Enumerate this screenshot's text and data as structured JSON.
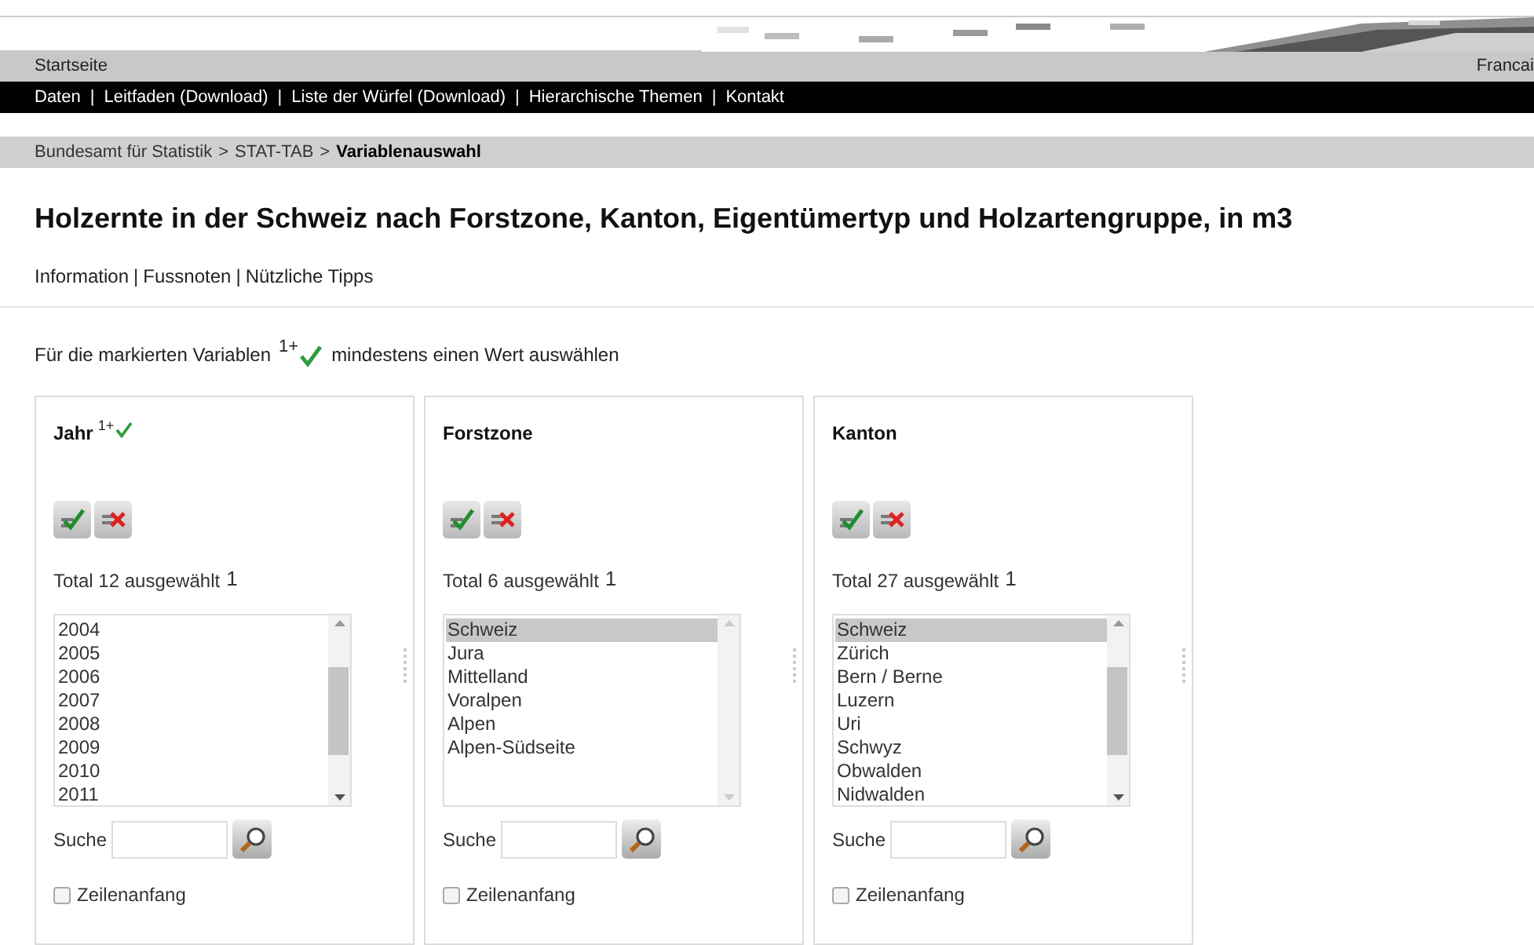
{
  "top_bar": {
    "home": "Startseite",
    "language": "Francai"
  },
  "nav": {
    "separator": "|",
    "items": [
      "Daten",
      "Leitfaden (Download)",
      "Liste der Würfel (Download)",
      "Hierarchische Themen",
      "Kontakt"
    ]
  },
  "breadcrumb": {
    "separator": ">",
    "items": [
      {
        "label": "Bundesamt für Statistik",
        "current": false
      },
      {
        "label": "STAT-TAB",
        "current": false
      },
      {
        "label": "Variablenauswahl",
        "current": true
      }
    ]
  },
  "title": "Holzernte in der Schweiz nach Forstzone, Kanton, Eigentümertyp und Holzartengruppe, in m3",
  "info_links": {
    "separator": "|",
    "items": [
      "Information",
      "Fussnoten",
      "Nützliche Tipps"
    ]
  },
  "instruction": {
    "before": "Für die markierten Variablen",
    "mark": "1+",
    "after": "mindestens einen Wert auswählen"
  },
  "panels": [
    {
      "title": "Jahr",
      "required_mark": "1+",
      "total": "Total 12 ausgewählt",
      "selected_count": "1",
      "options": [
        {
          "label": "2004",
          "selected": false
        },
        {
          "label": "2005",
          "selected": false
        },
        {
          "label": "2006",
          "selected": false
        },
        {
          "label": "2007",
          "selected": false
        },
        {
          "label": "2008",
          "selected": false
        },
        {
          "label": "2009",
          "selected": false
        },
        {
          "label": "2010",
          "selected": false
        },
        {
          "label": "2011",
          "selected": false
        }
      ],
      "scrollable": true,
      "search_label": "Suche",
      "checkbox": {
        "label": "Zeilenanfang",
        "checked": false
      }
    },
    {
      "title": "Forstzone",
      "total": "Total 6 ausgewählt",
      "selected_count": "1",
      "options": [
        {
          "label": "Schweiz",
          "selected": true
        },
        {
          "label": "Jura",
          "selected": false
        },
        {
          "label": "Mittelland",
          "selected": false
        },
        {
          "label": "Voralpen",
          "selected": false
        },
        {
          "label": "Alpen",
          "selected": false
        },
        {
          "label": "Alpen-Südseite",
          "selected": false
        }
      ],
      "scrollable": false,
      "search_label": "Suche",
      "checkbox": {
        "label": "Zeilenanfang",
        "checked": false
      }
    },
    {
      "title": "Kanton",
      "total": "Total 27 ausgewählt",
      "selected_count": "1",
      "options": [
        {
          "label": "Schweiz",
          "selected": true
        },
        {
          "label": "Zürich",
          "selected": false
        },
        {
          "label": "Bern / Berne",
          "selected": false
        },
        {
          "label": "Luzern",
          "selected": false
        },
        {
          "label": "Uri",
          "selected": false
        },
        {
          "label": "Schwyz",
          "selected": false
        },
        {
          "label": "Obwalden",
          "selected": false
        },
        {
          "label": "Nidwalden",
          "selected": false
        }
      ],
      "scrollable": true,
      "search_label": "Suche",
      "checkbox": {
        "label": "Zeilenanfang",
        "checked": false
      }
    }
  ]
}
